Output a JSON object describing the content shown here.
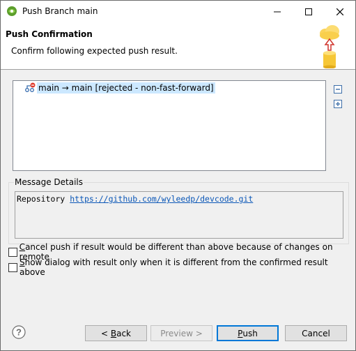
{
  "window": {
    "title": "Push Branch main",
    "icons": {
      "app": "eclipse-egit-icon",
      "minimize": "minimize-icon",
      "maximize": "maximize-icon",
      "close": "close-icon"
    }
  },
  "banner": {
    "title": "Push Confirmation",
    "description": "Confirm following expected push result.",
    "icon": "push-to-cloud-icon"
  },
  "results": {
    "rows": [
      {
        "label": "main → main [rejected - non-fast-forward]",
        "icon": "rejected-branch-icon"
      }
    ],
    "collapse_icon": "collapse-all-icon",
    "expand_icon": "expand-all-icon"
  },
  "message_details": {
    "group_label": "Message Details",
    "repository_label": "Repository",
    "repository_url": "https://github.com/wyleedp/devcode.git"
  },
  "options": {
    "cancel_if_different_prefix": "C",
    "cancel_if_different_rest": "ancel push if result would be different than above because of changes on remote",
    "cancel_if_different_checked": false,
    "show_only_if_different_prefix": "S",
    "show_only_if_different_rest": "how dialog with result only when it is different from the confirmed result above",
    "show_only_if_different_checked": false
  },
  "footer": {
    "help_icon": "help-icon",
    "back_prefix": "< ",
    "back_mnemonic": "B",
    "back_rest": "ack",
    "preview_label": "Preview >",
    "push_mnemonic": "P",
    "push_rest": "ush",
    "cancel_label": "Cancel"
  },
  "colors": {
    "selection": "#cce8ff",
    "link": "#0b57b7",
    "default_button_border": "#0078d7"
  }
}
